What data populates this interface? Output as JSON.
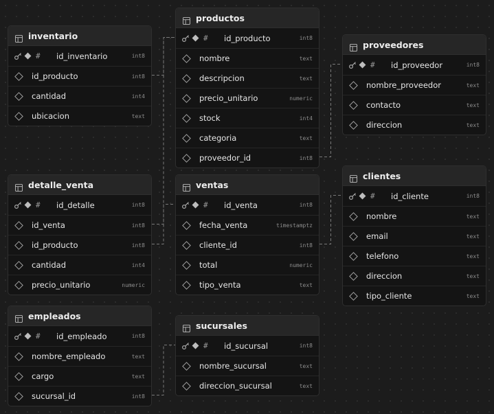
{
  "tables": [
    {
      "id": "inventario",
      "name": "inventario",
      "columns": [
        {
          "name": "id_inventario",
          "type": "int8",
          "pk": true
        },
        {
          "name": "id_producto",
          "type": "int8",
          "pk": false
        },
        {
          "name": "cantidad",
          "type": "int4",
          "pk": false
        },
        {
          "name": "ubicacion",
          "type": "text",
          "pk": false
        }
      ]
    },
    {
      "id": "productos",
      "name": "productos",
      "columns": [
        {
          "name": "id_producto",
          "type": "int8",
          "pk": true
        },
        {
          "name": "nombre",
          "type": "text",
          "pk": false
        },
        {
          "name": "descripcion",
          "type": "text",
          "pk": false
        },
        {
          "name": "precio_unitario",
          "type": "numeric",
          "pk": false
        },
        {
          "name": "stock",
          "type": "int4",
          "pk": false
        },
        {
          "name": "categoria",
          "type": "text",
          "pk": false
        },
        {
          "name": "proveedor_id",
          "type": "int8",
          "pk": false
        }
      ]
    },
    {
      "id": "proveedores",
      "name": "proveedores",
      "columns": [
        {
          "name": "id_proveedor",
          "type": "int8",
          "pk": true
        },
        {
          "name": "nombre_proveedor",
          "type": "text",
          "pk": false
        },
        {
          "name": "contacto",
          "type": "text",
          "pk": false
        },
        {
          "name": "direccion",
          "type": "text",
          "pk": false
        }
      ]
    },
    {
      "id": "detalle_venta",
      "name": "detalle_venta",
      "columns": [
        {
          "name": "id_detalle",
          "type": "int8",
          "pk": true
        },
        {
          "name": "id_venta",
          "type": "int8",
          "pk": false
        },
        {
          "name": "id_producto",
          "type": "int8",
          "pk": false
        },
        {
          "name": "cantidad",
          "type": "int4",
          "pk": false
        },
        {
          "name": "precio_unitario",
          "type": "numeric",
          "pk": false
        }
      ]
    },
    {
      "id": "ventas",
      "name": "ventas",
      "columns": [
        {
          "name": "id_venta",
          "type": "int8",
          "pk": true
        },
        {
          "name": "fecha_venta",
          "type": "timestamptz",
          "pk": false
        },
        {
          "name": "cliente_id",
          "type": "int8",
          "pk": false
        },
        {
          "name": "total",
          "type": "numeric",
          "pk": false
        },
        {
          "name": "tipo_venta",
          "type": "text",
          "pk": false
        }
      ]
    },
    {
      "id": "clientes",
      "name": "clientes",
      "columns": [
        {
          "name": "id_cliente",
          "type": "int8",
          "pk": true
        },
        {
          "name": "nombre",
          "type": "text",
          "pk": false
        },
        {
          "name": "email",
          "type": "text",
          "pk": false
        },
        {
          "name": "telefono",
          "type": "text",
          "pk": false
        },
        {
          "name": "direccion",
          "type": "text",
          "pk": false
        },
        {
          "name": "tipo_cliente",
          "type": "text",
          "pk": false
        }
      ]
    },
    {
      "id": "empleados",
      "name": "empleados",
      "columns": [
        {
          "name": "id_empleado",
          "type": "int8",
          "pk": true
        },
        {
          "name": "nombre_empleado",
          "type": "text",
          "pk": false
        },
        {
          "name": "cargo",
          "type": "text",
          "pk": false
        },
        {
          "name": "sucursal_id",
          "type": "int8",
          "pk": false
        }
      ]
    },
    {
      "id": "sucursales",
      "name": "sucursales",
      "columns": [
        {
          "name": "id_sucursal",
          "type": "int8",
          "pk": true
        },
        {
          "name": "nombre_sucursal",
          "type": "text",
          "pk": false
        },
        {
          "name": "direccion_sucursal",
          "type": "text",
          "pk": false
        }
      ]
    }
  ],
  "relations": [
    {
      "from": "inventario.id_producto",
      "to": "productos.id_producto"
    },
    {
      "from": "productos.proveedor_id",
      "to": "proveedores.id_proveedor"
    },
    {
      "from": "detalle_venta.id_venta",
      "to": "ventas.id_venta"
    },
    {
      "from": "detalle_venta.id_producto",
      "to": "productos.id_producto"
    },
    {
      "from": "ventas.cliente_id",
      "to": "clientes.id_cliente"
    },
    {
      "from": "empleados.sucursal_id",
      "to": "sucursales.id_sucursal"
    }
  ],
  "colors": {
    "canvas": "#1c1c1c",
    "table_bg": "#141414",
    "header_bg": "#262626",
    "border": "#2f2f2f",
    "connector": "#7a7a7a"
  }
}
